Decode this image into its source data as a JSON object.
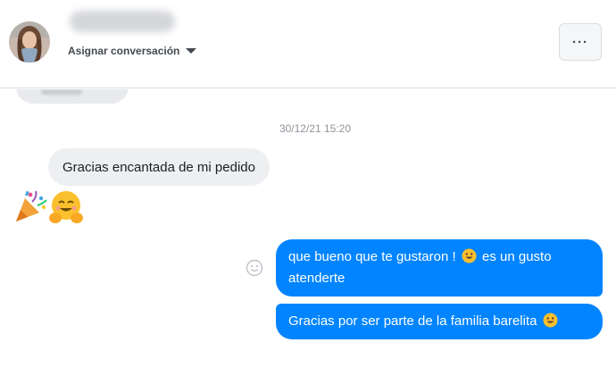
{
  "header": {
    "assign_label": "Asignar conversación"
  },
  "thread": {
    "timestamp": "30/12/21 15:20",
    "incoming": {
      "text": "Gracias encantada de mi pedido",
      "emojis": [
        "party-popper-emoji",
        "hugging-face-emoji"
      ]
    },
    "outgoing": [
      {
        "text_before": "que bueno que te gustaron !",
        "emoji": "smiley-emoji",
        "text_after": "es un gusto atenderte"
      },
      {
        "text_before": "Gracias por ser parte de la familia barelita",
        "emoji": "smiley-emoji",
        "text_after": ""
      }
    ]
  },
  "colors": {
    "outgoing_bubble": "#0084ff",
    "incoming_bubble": "#eeeff1",
    "timestamp": "#90949c"
  }
}
